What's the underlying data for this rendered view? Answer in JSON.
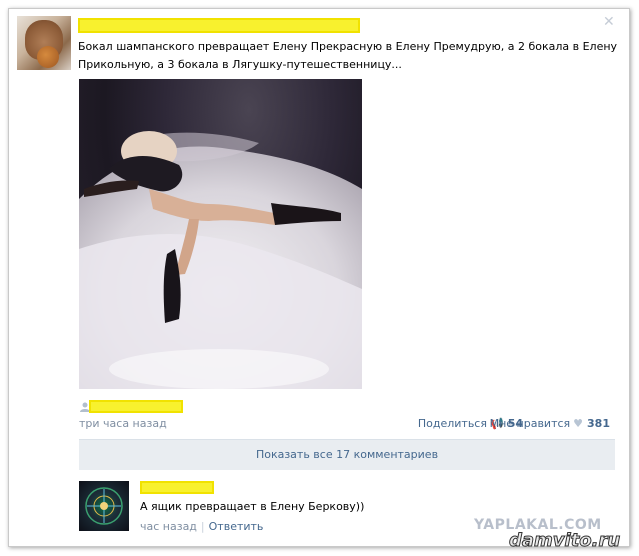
{
  "post": {
    "text": "Бокал шампанского превращает Елену Прекрасную в Елену Премудрую, а 2 бокала в Елену Прикольную, а 3 бокала в Лягушку-путешественницу...",
    "time": "три часа назад",
    "share_label": "Поделиться",
    "share_count": "54",
    "likes_label": "Мне нравится",
    "likes_count": "381"
  },
  "comments": {
    "show_all_label": "Показать все 17 комментариев",
    "items": [
      {
        "text": "А ящик превращает в Елену Беркову))",
        "time": "час назад",
        "reply_label": "Ответить"
      }
    ]
  },
  "watermarks": {
    "primary": "YAPLAKAL.COM",
    "secondary": "damvito.ru"
  },
  "colors": {
    "link": "#45688e",
    "muted": "#7f8ea1",
    "redaction": "#f8f12e",
    "button_bg": "#e9edf1"
  }
}
